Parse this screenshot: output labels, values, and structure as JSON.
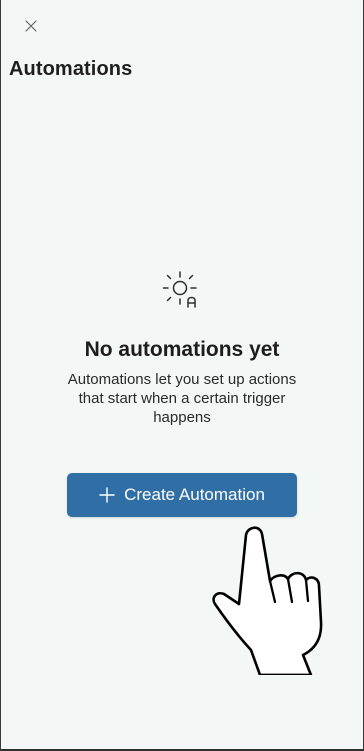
{
  "header": {
    "close_icon": "close-icon",
    "title": "Automations"
  },
  "empty_state": {
    "icon": "sun-automation-icon",
    "title": "No automations yet",
    "description": "Automations let you set up actions that start when a certain trigger happens"
  },
  "primary_action": {
    "icon": "plus-icon",
    "label": "Create Automation"
  },
  "overlay": {
    "icon": "hand-pointer-icon"
  },
  "colors": {
    "background": "#f3f8f7",
    "accent": "#2f6fa5",
    "text": "#1d1d1d"
  }
}
